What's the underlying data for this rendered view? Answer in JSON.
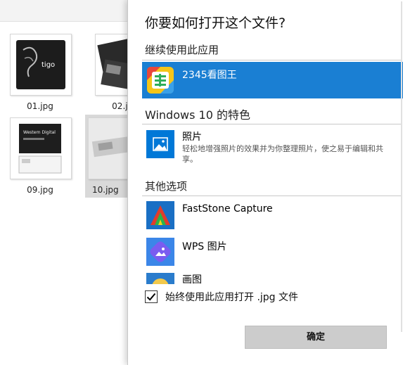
{
  "explorer": {
    "files": [
      {
        "name": "01.jpg",
        "thumb_text": "tigo",
        "selected": false
      },
      {
        "name": "02.jpg",
        "thumb_text": "",
        "selected": false
      },
      {
        "name": "09.jpg",
        "thumb_text": "Western Digital",
        "selected": false
      },
      {
        "name": "10.jpg",
        "thumb_text": "",
        "selected": true
      }
    ]
  },
  "dialog": {
    "title": "你要如何打开这个文件?",
    "continue_section": "继续使用此应用",
    "current_app": {
      "name": "2345看图王",
      "icon": "2345-viewer-icon"
    },
    "windows_section": "Windows 10 的特色",
    "photos_app": {
      "name": "照片",
      "description": "轻松地增强照片的效果并为你整理照片，使之易于编辑和共享。",
      "icon": "photos-icon"
    },
    "other_section": "其他选项",
    "other_apps": [
      {
        "name": "FastStone Capture",
        "icon": "faststone-capture-icon"
      },
      {
        "name": "WPS 图片",
        "icon": "wps-picture-icon"
      },
      {
        "name": "画图",
        "icon": "paint-icon"
      }
    ],
    "always_use": {
      "label": "始终使用此应用打开 .jpg 文件",
      "checked": true
    },
    "ok_label": "确定"
  },
  "colors": {
    "highlight": "#1a7fd3",
    "photos_icon": "#0078d7",
    "button": "#cccccc"
  }
}
